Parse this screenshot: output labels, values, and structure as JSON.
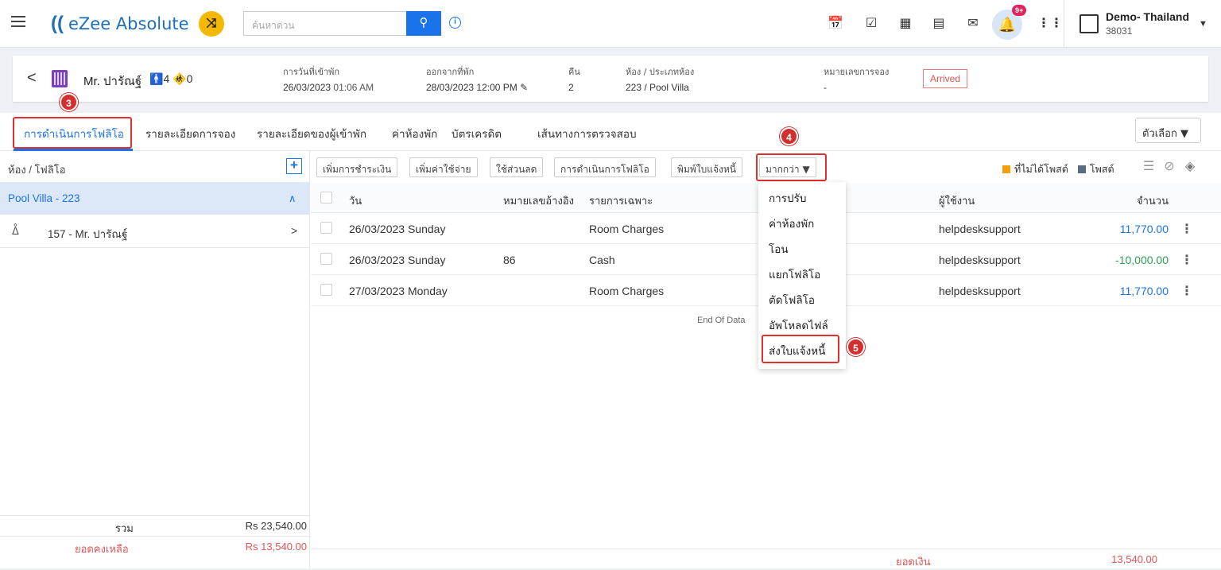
{
  "topbar": {
    "logo_text": "eZee Absolute",
    "search_placeholder": "ค้นหาด่วน",
    "notification_badge": "9+",
    "property_name": "Demo- Thailand",
    "property_id": "38031"
  },
  "reservation": {
    "guest_name": "Mr. ปารัณฐ์",
    "adults": "4",
    "children": "0",
    "checkin_label": "การวันที่เข้าพัก",
    "checkin_date": "26/03/2023",
    "checkin_time": "01:06 AM",
    "checkout_label": "ออกจากที่พัก",
    "checkout_date": "28/03/2023",
    "checkout_time": "12:00 PM",
    "nights_label": "คืน",
    "nights": "2",
    "room_label": "ห้อง / ประเภทห้อง",
    "room_value": "223 / Pool Villa",
    "resno_label": "หมายเลขการจอง",
    "resno_value": "-",
    "status": "Arrived"
  },
  "steps": {
    "s3": "3",
    "s4": "4",
    "s5": "5"
  },
  "tabs": [
    {
      "label": "การดำเนินการโฟลิโอ"
    },
    {
      "label": "รายละเอียดการจอง"
    },
    {
      "label": "รายละเอียดของผู้เข้าพัก"
    },
    {
      "label": "ค่าห้องพัก"
    },
    {
      "label": "บัตรเครดิต"
    },
    {
      "label": "เส้นทางการตรวจสอบ"
    }
  ],
  "options_label": "ตัวเลือก",
  "left_panel": {
    "header": "ห้อง / โฟลิโอ",
    "room": "Pool Villa - 223",
    "folio": "157 - Mr. ปารัณฐ์",
    "total_label": "รวม",
    "total_value": "Rs 23,540.00",
    "balance_label": "ยอดคงเหลือ",
    "balance_value": "Rs 13,540.00"
  },
  "toolbar": {
    "add_payment": "เพิ่มการชำระเงิน",
    "add_charge": "เพิ่มค่าใช้จ่าย",
    "apply_discount": "ใช้ส่วนลด",
    "folio_ops": "การดำเนินการโฟลิโอ",
    "print_invoice": "พิมพ์ใบแจ้งหนี้",
    "more": "มากกว่า",
    "legend_unposted": "ที่ไม่ได้โพสต์",
    "legend_posted": "โพสต์"
  },
  "table": {
    "headers": {
      "date": "วัน",
      "ref": "หมายเลขอ้างอิง",
      "desc": "รายการเฉพาะ",
      "user": "ผู้ใช้งาน",
      "amount": "จำนวน"
    },
    "rows": [
      {
        "date": "26/03/2023 Sunday",
        "ref": "",
        "desc": "Room Charges",
        "user": "helpdesksupport",
        "amount": "11,770.00"
      },
      {
        "date": "26/03/2023 Sunday",
        "ref": "86",
        "desc": "Cash",
        "user": "helpdesksupport",
        "amount": "-10,000.00"
      },
      {
        "date": "27/03/2023 Monday",
        "ref": "",
        "desc": "Room Charges",
        "user": "helpdesksupport",
        "amount": "11,770.00"
      }
    ],
    "end_text": "End Of Data",
    "footer_label": "ยอดเงิน",
    "footer_value": "13,540.00"
  },
  "more_menu": [
    "การปรับ",
    "ค่าห้องพัก",
    "โอน",
    "แยกโฟลิโอ",
    "ตัดโฟลิโอ",
    "อัพโหลดไฟล์",
    "ส่งใบแจ้งหนี้"
  ],
  "colors": {
    "accent": "#1a73e8",
    "brand_yellow": "#f5b800",
    "negative": "#2e9e4f",
    "danger": "#e05555",
    "unposted": "#f59e0b",
    "posted": "#5a6b80"
  }
}
